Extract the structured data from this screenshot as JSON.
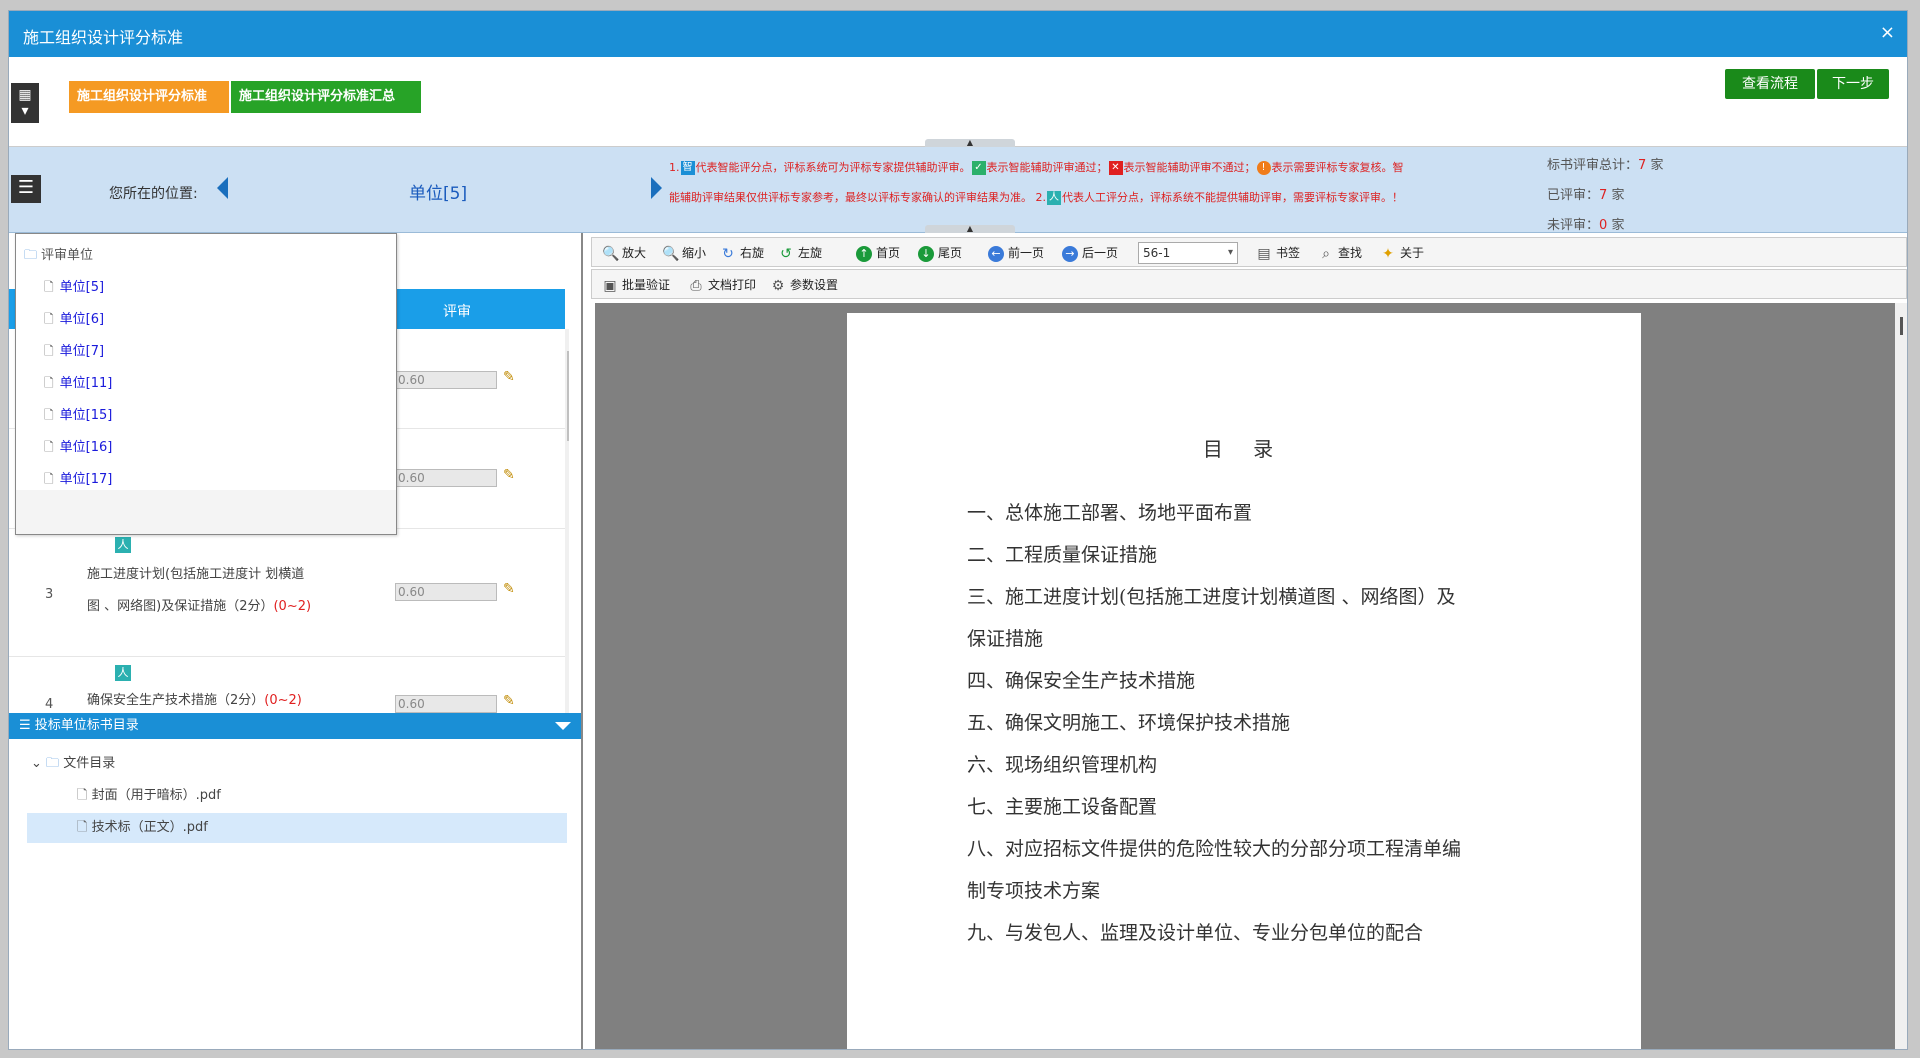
{
  "window": {
    "title": "施工组织设计评分标准",
    "close": "×"
  },
  "topbar": {
    "tab1": "施工组织设计评分标准",
    "tab2": "施工组织设计评分标准汇总",
    "flow_button": "查看流程",
    "next_button": "下一步"
  },
  "location": {
    "label": "您所在的位置:",
    "value": "单位[5]"
  },
  "legend": {
    "n1": "1.",
    "zhi": "智",
    "t1": "代表智能评分点，评标系统可为评标专家提供辅助评审。",
    "t2": "表示智能辅助评审通过；",
    "t3": "表示智能辅助评审不通过；",
    "warn": "!",
    "t4": "表示需要评标专家复核。智能辅助评审结果仅供评标专家参考，最终以评标专家确认的评审结果为准。",
    "n2": "2.",
    "ren": "人",
    "t5": "代表人工评分点，评标系统不能提供辅助评审，需要评标专家评审。！"
  },
  "stats": {
    "total_label": "标书评审总计：",
    "total": "7",
    "unit1": "家",
    "done_label": "已评审：",
    "done": "7",
    "unit2": "家",
    "todo_label": "未评审：",
    "todo": "0",
    "unit3": "家"
  },
  "unit_popup": {
    "root": "评审单位",
    "items": [
      "单位[5]",
      "单位[6]",
      "单位[7]",
      "单位[11]",
      "单位[15]",
      "单位[16]",
      "单位[17]"
    ]
  },
  "score": {
    "header": "评审",
    "rows": [
      {
        "value": "0.60"
      },
      {
        "value": "0.60"
      },
      {
        "idx": "3",
        "badge": "人",
        "text1": "施工进度计划(包括施工进度计 划横道",
        "text2": "图 、网络图)及保证措施（2分）",
        "range": "(0~2)",
        "value": "0.60"
      },
      {
        "idx": "4",
        "badge": "人",
        "text1": "确保安全生产技术措施（2分）",
        "range": "(0~2)",
        "value": "0.60"
      }
    ]
  },
  "directory": {
    "header": "投标单位标书目录",
    "root": "文件目录",
    "files": [
      "封面（用于暗标）.pdf",
      "技术标（正文）.pdf"
    ]
  },
  "viewer": {
    "toolbar1": {
      "zoom_in": "放大",
      "zoom_out": "缩小",
      "rotate_right": "右旋",
      "rotate_left": "左旋",
      "first": "首页",
      "last": "尾页",
      "prev": "前一页",
      "next": "后一页",
      "page": "56-1",
      "bookmark": "书签",
      "find": "查找",
      "about": "关于"
    },
    "toolbar2": {
      "batch_verify": "批量验证",
      "print": "文档打印",
      "settings": "参数设置"
    },
    "page": {
      "title": "目  录",
      "lines": [
        "一、总体施工部署、场地平面布置",
        "二、工程质量保证措施",
        "三、施工进度计划(包括施工进度计划横道图 、网络图）及",
        "保证措施",
        "四、确保安全生产技术措施",
        "五、确保文明施工、环境保护技术措施",
        "六、现场组织管理机构",
        "七、主要施工设备配置",
        "八、对应招标文件提供的危险性较大的分部分项工程清单编",
        "制专项技术方案",
        "九、与发包人、监理及设计单位、专业分包单位的配合"
      ]
    }
  }
}
